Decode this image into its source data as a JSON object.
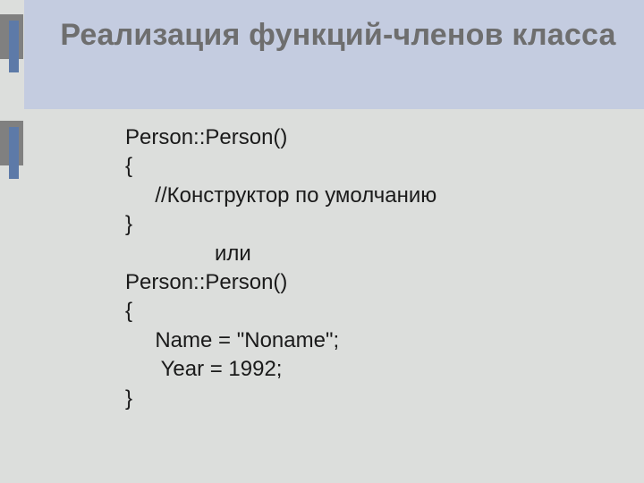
{
  "title": "Реализация функций-членов класса",
  "code": {
    "l1": "Person::Person()",
    "l2": "{",
    "l3": "     //Конструктор по умолчанию",
    "l4": "}",
    "l5": "",
    "l6": "               или",
    "l7": "",
    "l8": "Person::Person()",
    "l9": "{",
    "l10": "     Name = \"Noname\";",
    "l11": "      Year = 1992;",
    "l12": "}"
  }
}
